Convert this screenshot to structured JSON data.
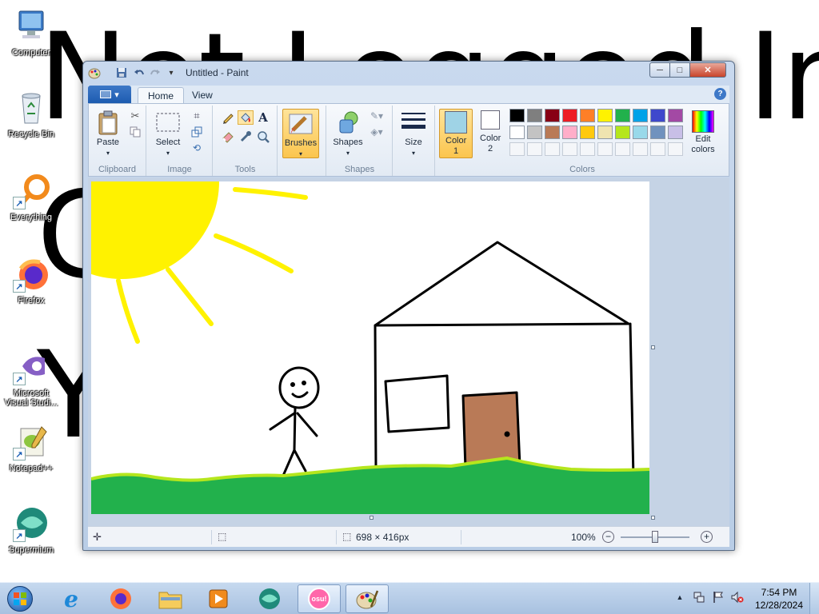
{
  "wallpaper_text": {
    "line1": "Not Logged In",
    "line2": "G",
    "line3": "Y"
  },
  "desktop_icons": [
    {
      "label": "Computer"
    },
    {
      "label": "Recycle Bin"
    },
    {
      "label": "Everything"
    },
    {
      "label": "Firefox"
    },
    {
      "label": "Microsoft Visual Studi..."
    },
    {
      "label": "Notepad++"
    },
    {
      "label": "Supermium"
    }
  ],
  "window": {
    "title": "Untitled - Paint",
    "controls": {
      "minimize": "─",
      "maximize": "□",
      "close": "✕"
    }
  },
  "ribbon": {
    "file_menu_label": "▾",
    "tabs": [
      {
        "label": "Home"
      },
      {
        "label": "View"
      }
    ],
    "help_label": "?",
    "groups": {
      "clipboard": "Clipboard",
      "image": "Image",
      "tools": "Tools",
      "shapes": "Shapes",
      "colors": "Colors"
    },
    "buttons": {
      "paste": "Paste",
      "select": "Select",
      "brushes": "Brushes",
      "shapes": "Shapes",
      "size": "Size",
      "color1": "Color 1",
      "color2": "Color 2",
      "edit_colors": "Edit colors"
    },
    "color1": "#9fd3e6",
    "color2": "#ffffff",
    "palette_row1": [
      "#000000",
      "#7f7f7f",
      "#880015",
      "#ed1c24",
      "#ff7f27",
      "#fff200",
      "#22b14c",
      "#00a2e8",
      "#3f48cc",
      "#a349a4"
    ],
    "palette_row2": [
      "#ffffff",
      "#c3c3c3",
      "#b97a57",
      "#ffaec9",
      "#ffc90e",
      "#efe4b0",
      "#b5e61d",
      "#99d9ea",
      "#7092be",
      "#c8bfe7"
    ]
  },
  "statusbar": {
    "dimensions": "698 × 416px",
    "zoom": "100%",
    "zoom_out": "−",
    "zoom_in": "+"
  },
  "taskbar": {
    "time": "7:54 PM",
    "date": "12/28/2024",
    "osu_label": "osu!"
  }
}
